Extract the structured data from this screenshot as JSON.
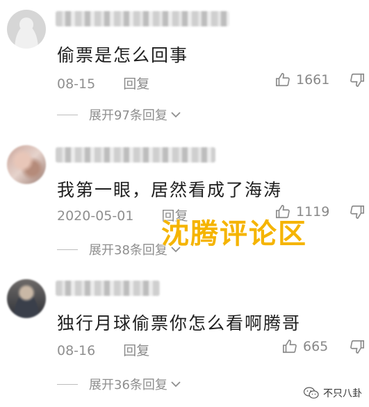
{
  "comments": [
    {
      "text": "偷票是怎么回事",
      "date": "08-15",
      "reply_label": "回复",
      "likes": "1661",
      "expand_label": "展开97条回复"
    },
    {
      "text": "我第一眼，居然看成了海涛",
      "date": "2020-05-01",
      "reply_label": "回复",
      "likes": "1119",
      "expand_label": "展开38条回复"
    },
    {
      "text": "独行月球偷票你怎么看啊腾哥",
      "date": "08-16",
      "reply_label": "回复",
      "likes": "665",
      "expand_label": "展开36条回复"
    }
  ],
  "watermark": "沈腾评论区",
  "brand": {
    "label": "不只八卦",
    "icon": "wechat-icon"
  },
  "colors": {
    "watermark": "#f5b400",
    "meta": "#8f8f8f"
  }
}
